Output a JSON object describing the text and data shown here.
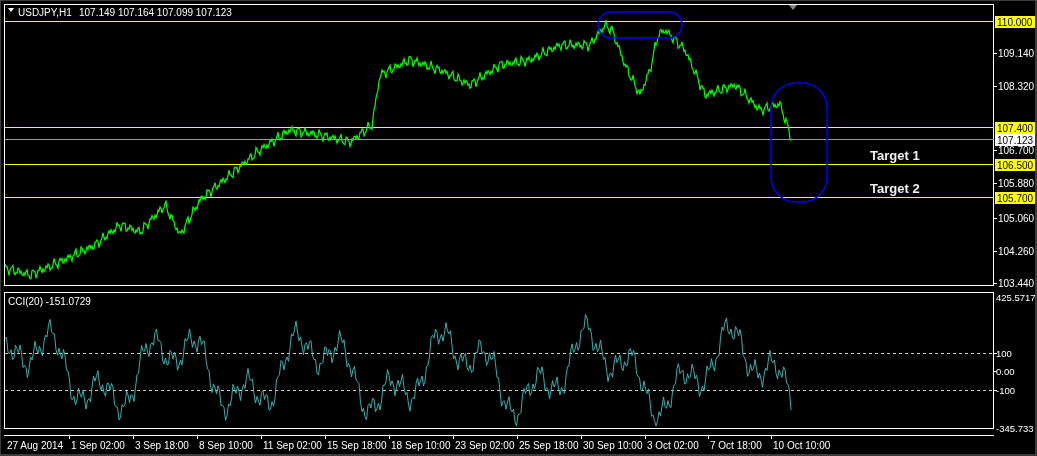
{
  "header": {
    "symbol": "USDJPY,H1",
    "ohlc": "107.149 107.164 107.099 107.123"
  },
  "price_axis": {
    "ticks": [
      "109.140",
      "108.320",
      "106.700",
      "105.880",
      "105.060",
      "104.260",
      "103.440"
    ]
  },
  "levels": [
    {
      "label": "110.000"
    },
    {
      "label": "107.400"
    },
    {
      "label": "106.500"
    },
    {
      "label": "105.700"
    }
  ],
  "current_price": "107.123",
  "targets": [
    "Target 1",
    "Target 2"
  ],
  "indicator": {
    "title": "CCI(20) -151.0729",
    "axis": [
      "425.5717",
      "100",
      "0.00",
      "-100",
      "-345.733"
    ]
  },
  "time_axis": [
    "27 Aug 2014",
    "1 Sep 02:00",
    "3 Sep 18:00",
    "8 Sep 10:00",
    "11 Sep 02:00",
    "15 Sep 18:00",
    "18 Sep 10:00",
    "23 Sep 02:00",
    "25 Sep 18:00",
    "30 Sep 10:00",
    "3 Oct 02:00",
    "7 Oct 18:00",
    "10 Oct 10:00"
  ]
}
